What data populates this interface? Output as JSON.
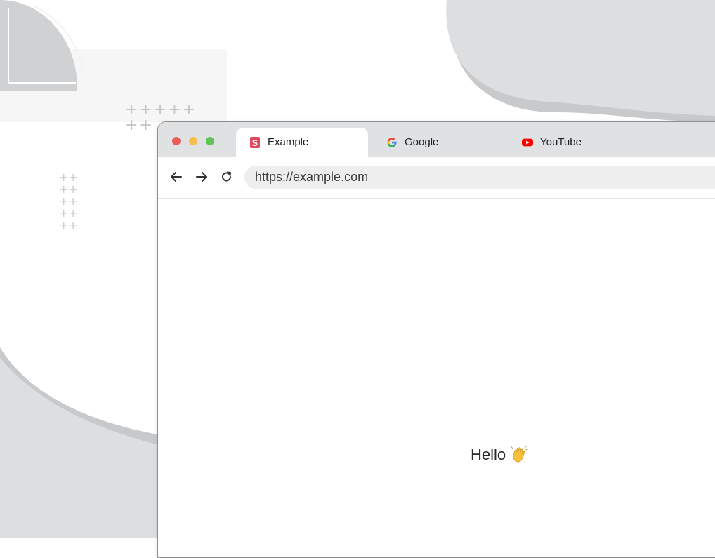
{
  "window_controls": {
    "close": "close",
    "minimize": "minimize",
    "zoom": "zoom"
  },
  "tabs": [
    {
      "label": "Example",
      "icon": "s-logo-icon",
      "active": true
    },
    {
      "label": "Google",
      "icon": "google-g-icon",
      "active": false
    },
    {
      "label": "YouTube",
      "icon": "youtube-icon",
      "active": false
    }
  ],
  "toolbar": {
    "back": "back-arrow-icon",
    "forward": "forward-arrow-icon",
    "reload": "reload-icon",
    "url": "https://example.com"
  },
  "page": {
    "greeting": "Hello",
    "emoji": "waving-hand-icon"
  },
  "colors": {
    "close": "#ec5d5a",
    "minimize": "#f4bf50",
    "zoom": "#5fc453",
    "tabstrip": "#dfe1e3",
    "omnibox": "#eeeeef",
    "backdrop_shape": "#d9dbdd"
  }
}
